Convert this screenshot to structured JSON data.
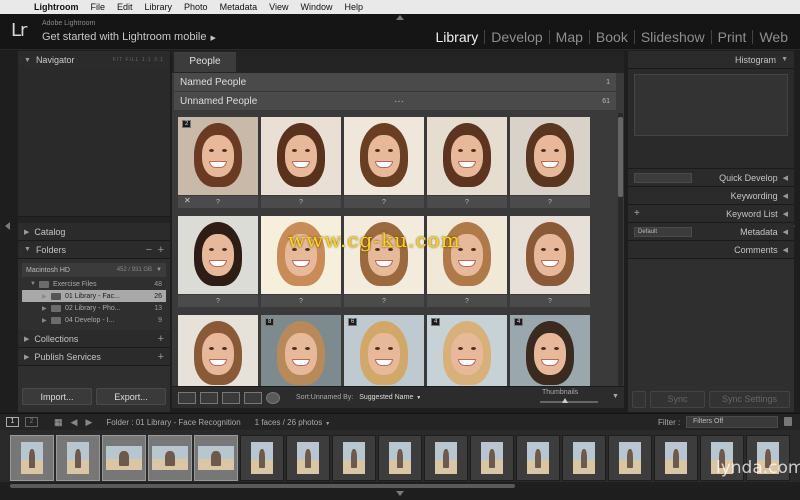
{
  "menubar": {
    "items": [
      "Lightroom",
      "File",
      "Edit",
      "Library",
      "Photo",
      "Metadata",
      "View",
      "Window",
      "Help"
    ]
  },
  "identity": {
    "logo": "Lr",
    "app_name": "Adobe Lightroom",
    "mobile_link": "Get started with Lightroom mobile",
    "mobile_arrow": "▶"
  },
  "modules": [
    "Library",
    "Develop",
    "Map",
    "Book",
    "Slideshow",
    "Print",
    "Web"
  ],
  "active_module": "Library",
  "left_panel": {
    "navigator": "Navigator",
    "catalog": "Catalog",
    "folders": "Folders",
    "volume": {
      "name": "Macintosh HD",
      "size": "452 / 931 GB"
    },
    "folder_rows": [
      {
        "name": "Exercise Files",
        "count": "48",
        "level": 1,
        "selected": false
      },
      {
        "name": "01 Library - Fac...",
        "count": "26",
        "level": 2,
        "selected": true
      },
      {
        "name": "02 Library - Pho...",
        "count": "13",
        "level": 2,
        "selected": false
      },
      {
        "name": "04 Develop - I...",
        "count": "9",
        "level": 2,
        "selected": false
      }
    ],
    "collections": "Collections",
    "publish": "Publish Services",
    "import_btn": "Import...",
    "export_btn": "Export..."
  },
  "center": {
    "tab": "People",
    "named_people": {
      "label": "Named People",
      "count": "1"
    },
    "unnamed_people": {
      "label": "Unnamed People",
      "count": "61",
      "dots": "···"
    },
    "unnamed_label": "?",
    "badges": [
      "2",
      "8",
      "6",
      "4",
      "4"
    ],
    "watermark": "www.cg-ku.com"
  },
  "toolbar": {
    "sort_label": "Sort:Unnamed By:",
    "sort_value": "Suggested Name",
    "thumbnails_label": "Thumbnails"
  },
  "right_panel": {
    "histogram": "Histogram",
    "quick_develop": "Quick Develop",
    "keywording": "Keywording",
    "keyword_list": "Keyword List",
    "metadata": "Metadata",
    "metadata_preset": "Default",
    "comments": "Comments",
    "sync_btn": "Sync",
    "sync_settings_btn": "Sync Settings"
  },
  "filmstrip": {
    "monitor1": "1",
    "monitor2": "2",
    "folder_path": "Folder : 01 Library - Face Recognition",
    "face_count": "1 faces / 26 photos",
    "filter_label": "Filter :",
    "filter_value": "Filters Off",
    "watermark": "lynda.com"
  },
  "colors": {
    "accent_selected": "#a8a8a8",
    "watermark_yellow": "#ffd21a"
  }
}
